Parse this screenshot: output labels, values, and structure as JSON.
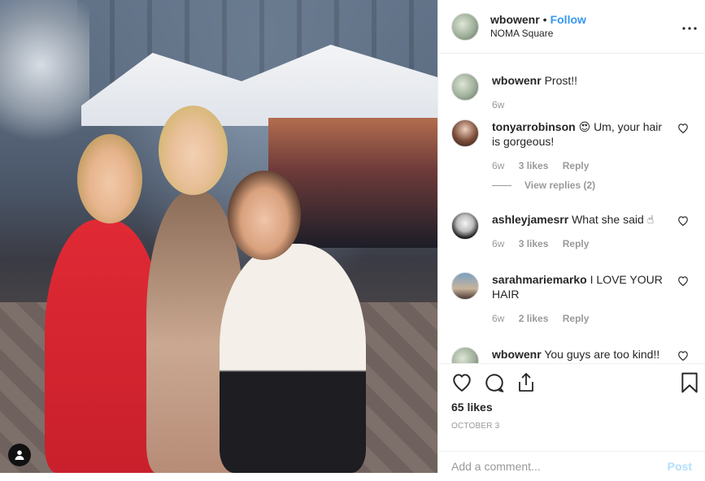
{
  "post": {
    "username": "wbowenr",
    "separator": "•",
    "follow_label": "Follow",
    "location": "NOMA Square",
    "more_icon": "more-options-icon"
  },
  "caption": {
    "username": "wbowenr",
    "text": "Prost!!",
    "time": "6w"
  },
  "comments": [
    {
      "username": "tonyarrobinson",
      "emoji": "😍",
      "text": "Um, your hair is gorgeous!",
      "time": "6w",
      "likes": "3 likes",
      "reply": "Reply",
      "view_replies": "View replies (2)"
    },
    {
      "username": "ashleyjamesrr",
      "text": "What she said",
      "emoji": "☝",
      "time": "6w",
      "likes": "3 likes",
      "reply": "Reply"
    },
    {
      "username": "sarahmariemarko",
      "text": "I LOVE YOUR HAIR",
      "time": "6w",
      "likes": "2 likes",
      "reply": "Reply"
    },
    {
      "username": "wbowenr",
      "text": "You guys are too kind!!"
    }
  ],
  "actions": {
    "likes": "65 likes",
    "date": "OCTOBER 3"
  },
  "add_comment": {
    "placeholder": "Add a comment...",
    "post_label": "Post"
  },
  "colors": {
    "follow": "#3897f0",
    "post_disabled": "#b2dffc",
    "muted": "#999999"
  }
}
